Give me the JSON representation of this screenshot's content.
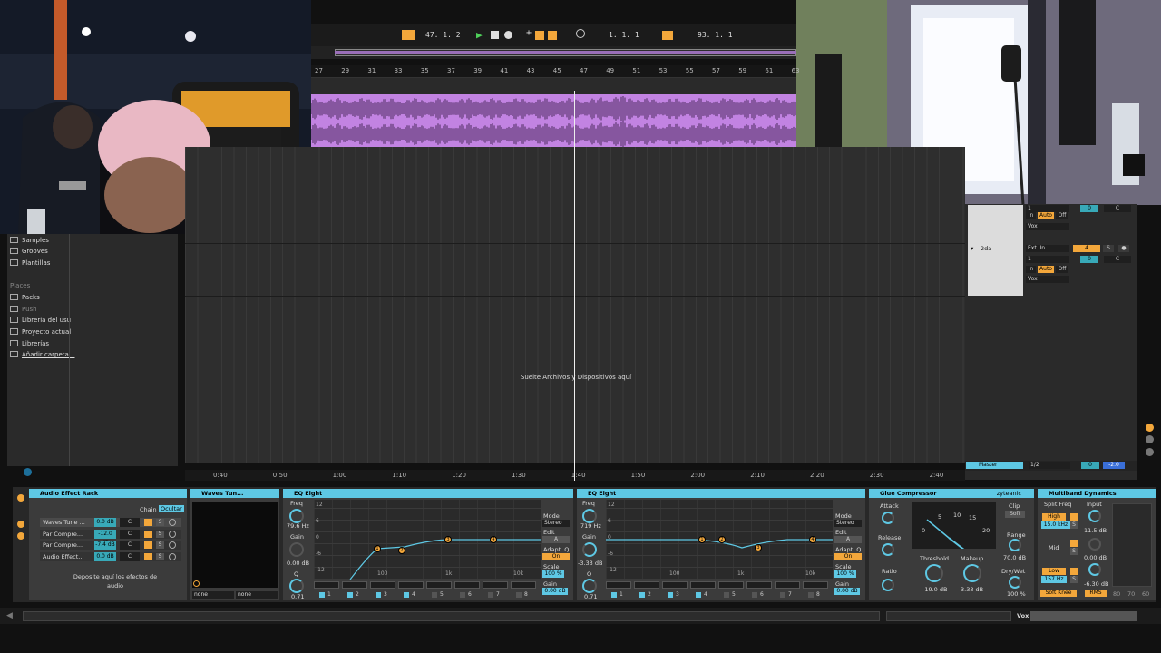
{
  "transport": {
    "position": "47.  1.  2",
    "loop_start": "1.  1.  1",
    "loop_length": "93.  1.  1"
  },
  "ruler_bars": [
    "27",
    "29",
    "31",
    "33",
    "35",
    "37",
    "39",
    "41",
    "43",
    "45",
    "47",
    "49",
    "51",
    "53",
    "55",
    "57",
    "59",
    "61",
    "63"
  ],
  "arrangement": {
    "drop_text": "Suelte Archivos y Dispositivos aquí"
  },
  "time_ruler": [
    "0:40",
    "0:50",
    "1:00",
    "1:10",
    "1:20",
    "1:30",
    "1:40",
    "1:50",
    "2:00",
    "2:10",
    "2:20",
    "2:30",
    "2:40"
  ],
  "browser": {
    "categories": [
      "Samples",
      "Grooves",
      "Plantillas"
    ],
    "places_label": "Places",
    "places": [
      "Packs",
      "Push",
      "Librería del usu",
      "Proyecto actual",
      "Librerías",
      "Añadir carpeta..."
    ]
  },
  "mixer": {
    "track1": {
      "in": "In",
      "auto": "Auto",
      "off": "Off",
      "input_ch": "1",
      "send": "0",
      "pan": "C",
      "output": "Vox"
    },
    "track2": {
      "name": "2da",
      "input": "Ext. In",
      "input_ch": "1",
      "number": "4",
      "solo": "S",
      "send": "0",
      "pan": "C",
      "in": "In",
      "auto": "Auto",
      "off": "Off",
      "output": "Vox"
    },
    "master": {
      "name": "Master",
      "routing": "1/2",
      "volume": "0",
      "pan": "-2.0"
    }
  },
  "rack": {
    "title": "Audio Effect Rack",
    "chain_label": "Chain",
    "hide_label": "Ocultar",
    "chains": [
      {
        "name": "Waves Tune ...",
        "vol": "0.0 dB",
        "pan": "C"
      },
      {
        "name": "Par Compre...",
        "vol": "-12.0 dB",
        "pan": "C"
      },
      {
        "name": "Par Compre...",
        "vol": "-7.4 dB",
        "pan": "C"
      },
      {
        "name": "Audio Effect...",
        "vol": "0.0 dB",
        "pan": "C"
      }
    ],
    "drop_text": "Deposite aquí los efectos de audio"
  },
  "waves": {
    "title": "Waves Tun...",
    "sel1": "none",
    "sel2": "none"
  },
  "eq1": {
    "title": "EQ Eight",
    "freq_label": "Freq",
    "freq": "79.6 Hz",
    "gain_label": "Gain",
    "gain": "0.00 dB",
    "q_label": "Q",
    "q": "0.71",
    "db": [
      "12",
      "6",
      "0",
      "-6",
      "-12"
    ],
    "freq_ticks": [
      "100",
      "1k",
      "10k"
    ],
    "mode_label": "Mode",
    "mode": "Stereo",
    "edit_label": "Edit",
    "edit": "A",
    "adapt_label": "Adapt. Q",
    "adapt": "On",
    "scale_label": "Scale",
    "scale": "100 %",
    "out_gain_label": "Gain",
    "out_gain": "0.00 dB",
    "bands": [
      "1",
      "2",
      "3",
      "4",
      "5",
      "6",
      "7",
      "8"
    ],
    "nodes": [
      "1",
      "2",
      "3",
      "4"
    ]
  },
  "eq2": {
    "title": "EQ Eight",
    "freq_label": "Freq",
    "freq": "719 Hz",
    "gain_label": "Gain",
    "gain": "-3.33 dB",
    "q_label": "Q",
    "q": "0.71",
    "db": [
      "12",
      "6",
      "0",
      "-6",
      "-12"
    ],
    "freq_ticks": [
      "100",
      "1k",
      "10k"
    ],
    "mode_label": "Mode",
    "mode": "Stereo",
    "edit_label": "Edit",
    "edit": "A",
    "adapt_label": "Adapt. Q",
    "adapt": "On",
    "scale_label": "Scale",
    "scale": "100 %",
    "out_gain_label": "Gain",
    "out_gain": "0.00 dB",
    "bands": [
      "1",
      "2",
      "3",
      "4",
      "5",
      "6",
      "7",
      "8"
    ],
    "nodes": [
      "1",
      "2",
      "3",
      "4"
    ]
  },
  "glue": {
    "title": "Glue Compressor",
    "preset": "zyteanic",
    "attack_label": "Attack",
    "release_label": "Release",
    "ratio_label": "Ratio",
    "clip_label": "Clip",
    "soft": "Soft",
    "threshold_label": "Threshold",
    "threshold": "-19.0 dB",
    "makeup_label": "Makeup",
    "makeup": "3.33 dB",
    "range_label": "Range",
    "range": "70.0 dB",
    "drywet_label": "Dry/Wet",
    "drywet": "100 %",
    "meter_ticks": [
      "0",
      "5",
      "10",
      "15",
      "20"
    ]
  },
  "multiband": {
    "title": "Multiband Dynamics",
    "split_label": "Split Freq",
    "input_label": "Input",
    "high_label": "High",
    "high_freq": "15.0 kHz",
    "input_high": "11.5 dB",
    "mid_label": "Mid",
    "input_mid": "0.00 dB",
    "low_label": "Low",
    "low_freq": "157 Hz",
    "input_low": "-6.30 dB",
    "soft_knee": "Soft Knee",
    "rms": "RMS",
    "scale": [
      "80",
      "70",
      "60"
    ]
  },
  "status": {
    "track": "Vox"
  },
  "colors": {
    "accent": "#f3a73b",
    "device_header": "#5ec8e4",
    "clip": "#c283e2"
  }
}
